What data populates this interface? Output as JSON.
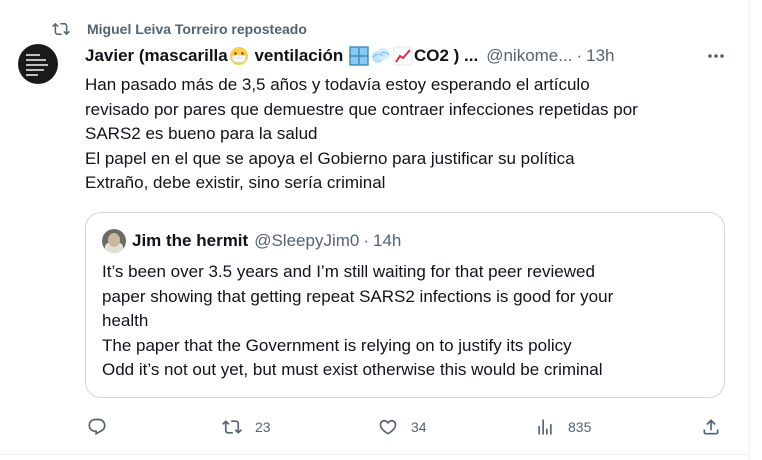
{
  "repost": {
    "icon": "repost-icon",
    "text": "Miguel Leiva Torreiro reposteado"
  },
  "tweet": {
    "author_name_prefix": "Javier (mascarilla",
    "author_name_middle": " ventilación ",
    "author_name_suffix": "CO2 ) ...",
    "author_emojis": [
      "mask-emoji",
      "window-emoji",
      "dash-emoji",
      "chart-increasing-emoji"
    ],
    "handle": "@nikome...",
    "separator": "·",
    "time": "13h",
    "more_icon": "more-icon",
    "text_lines": [
      "Han pasado más de 3,5 años y todavía estoy esperando el artículo",
      "revisado por pares que demuestre que contraer infecciones repetidas por",
      "SARS2 es bueno para la salud",
      "El papel en el que se apoya el Gobierno para justificar su política",
      "Extraño, debe existir, sino sería criminal"
    ]
  },
  "quote": {
    "name": "Jim the hermit",
    "handle": "@SleepyJim0",
    "separator": "·",
    "time": "14h",
    "text_lines": [
      "It’s been over 3.5 years and I’m still waiting for that peer reviewed",
      "paper showing that getting repeat SARS2 infections is good for your",
      "health",
      "The paper that the Government is relying on to justify its policy",
      "Odd it’s not out yet, but must exist otherwise this would be criminal"
    ]
  },
  "actions": {
    "reply": {
      "icon": "reply-icon"
    },
    "repost": {
      "icon": "repost-icon",
      "count": "23"
    },
    "like": {
      "icon": "like-icon",
      "count": "34"
    },
    "views": {
      "icon": "views-icon",
      "count": "835"
    },
    "share": {
      "icon": "share-icon"
    }
  },
  "colors": {
    "text": "#0f1419",
    "secondary": "#536471",
    "border": "#cfd9de"
  }
}
